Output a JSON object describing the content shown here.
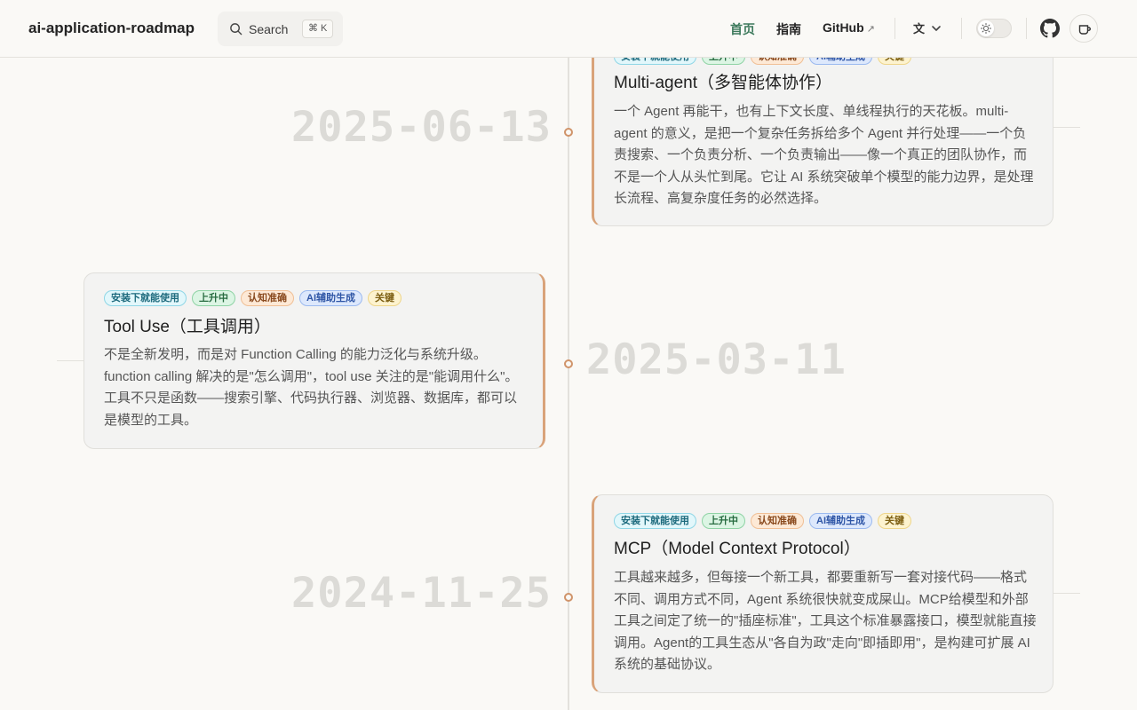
{
  "header": {
    "site_title": "ai-application-roadmap",
    "search_label": "Search",
    "search_shortcut": "⌘ K",
    "nav": [
      {
        "label": "首页",
        "active": true
      },
      {
        "label": "指南",
        "active": false
      },
      {
        "label": "GitHub",
        "external": true
      }
    ],
    "icons": [
      "search-icon",
      "translate-icon",
      "theme-toggle",
      "github-icon",
      "coffee-cup-icon"
    ]
  },
  "tag_styles": [
    {
      "bg": "#e2f7fb",
      "border": "#8fd6e6",
      "color": "#1d6a7d"
    },
    {
      "bg": "#dcf5e4",
      "border": "#8fd3a5",
      "color": "#276b40"
    },
    {
      "bg": "#fde9d6",
      "border": "#f0bf95",
      "color": "#8a4a1e"
    },
    {
      "bg": "#dde8fc",
      "border": "#9bb9ef",
      "color": "#2f56a6"
    },
    {
      "bg": "#fdf3cf",
      "border": "#eed58a",
      "color": "#7d5f12"
    }
  ],
  "timeline": [
    {
      "date": "2025-06-13",
      "side": "right",
      "tags": [
        "安装下就能使用",
        "上升中",
        "认知准确",
        "AI辅助生成",
        "关键"
      ],
      "title": "Multi-agent（多智能体协作）",
      "body": "一个 Agent 再能干，也有上下文长度、单线程执行的天花板。multi-agent 的意义，是把一个复杂任务拆给多个 Agent 并行处理——一个负责搜索、一个负责分析、一个负责输出——像一个真正的团队协作，而不是一个人从头忙到尾。它让 AI 系统突破单个模型的能力边界，是处理长流程、高复杂度任务的必然选择。"
    },
    {
      "date": "2025-03-11",
      "side": "left",
      "tags": [
        "安装下就能使用",
        "上升中",
        "认知准确",
        "AI辅助生成",
        "关键"
      ],
      "title": "Tool Use（工具调用）",
      "body": "不是全新发明，而是对 Function Calling 的能力泛化与系统升级。function calling 解决的是\"怎么调用\"，tool use 关注的是\"能调用什么\"。工具不只是函数——搜索引擎、代码执行器、浏览器、数据库，都可以是模型的工具。"
    },
    {
      "date": "2024-11-25",
      "side": "right",
      "tags": [
        "安装下就能使用",
        "上升中",
        "认知准确",
        "AI辅助生成",
        "关键"
      ],
      "title": "MCP（Model Context Protocol）",
      "body": "工具越来越多，但每接一个新工具，都要重新写一套对接代码——格式不同、调用方式不同，Agent 系统很快就变成屎山。MCP给模型和外部工具之间定了统一的\"插座标准\"，工具这个标准暴露接口，模型就能直接调用。Agent的工具生态从\"各自为政\"走向\"即插即用\"，是构建可扩展 AI 系统的基础协议。"
    }
  ]
}
